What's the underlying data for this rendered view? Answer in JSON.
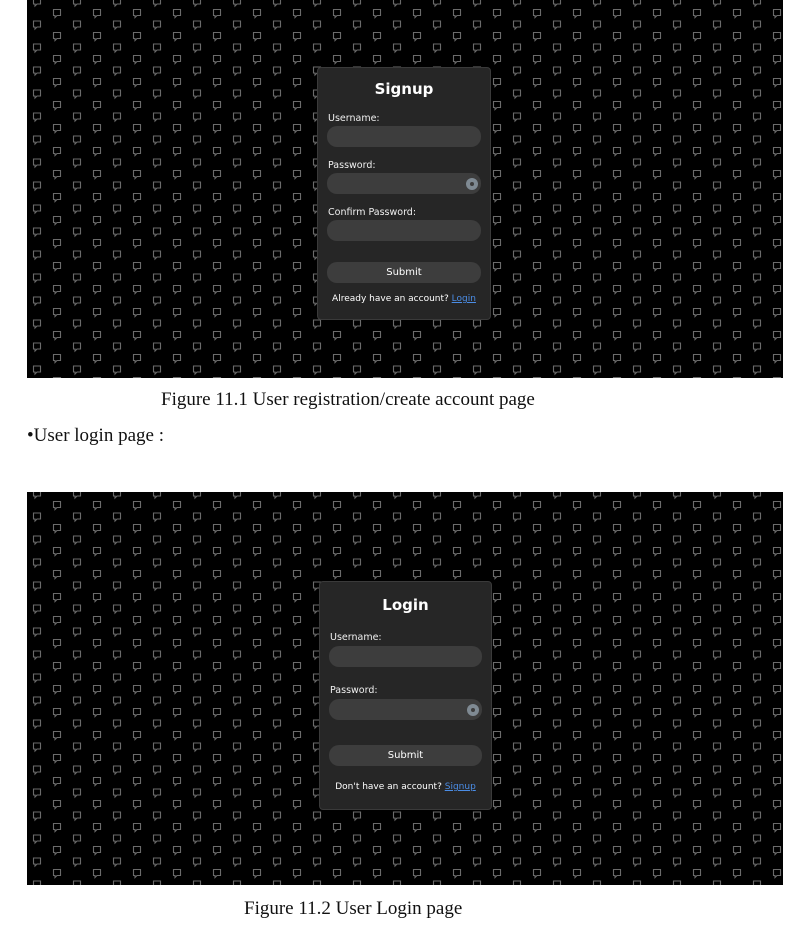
{
  "figure1": {
    "card": {
      "title": "Signup",
      "username_label": "Username:",
      "password_label": "Password:",
      "confirm_label": "Confirm Password:",
      "submit_label": "Submit",
      "footer_text": "Already have an account? ",
      "footer_link": "Login"
    },
    "caption": "Figure 11.1 User registration/create account page"
  },
  "section_heading": "•User login page :",
  "figure2": {
    "card": {
      "title": "Login",
      "username_label": "Username:",
      "password_label": "Password:",
      "submit_label": "Submit",
      "footer_text": "Don't have an account? ",
      "footer_link": "Signup"
    },
    "caption": "Figure 11.2 User Login page"
  },
  "colors": {
    "background": "#000000",
    "card": "#262626",
    "input": "#3d3d3d",
    "link": "#4b8de6"
  },
  "icons": {
    "password_toggle": "eye-icon",
    "pattern": "chat-bubble-icon"
  }
}
